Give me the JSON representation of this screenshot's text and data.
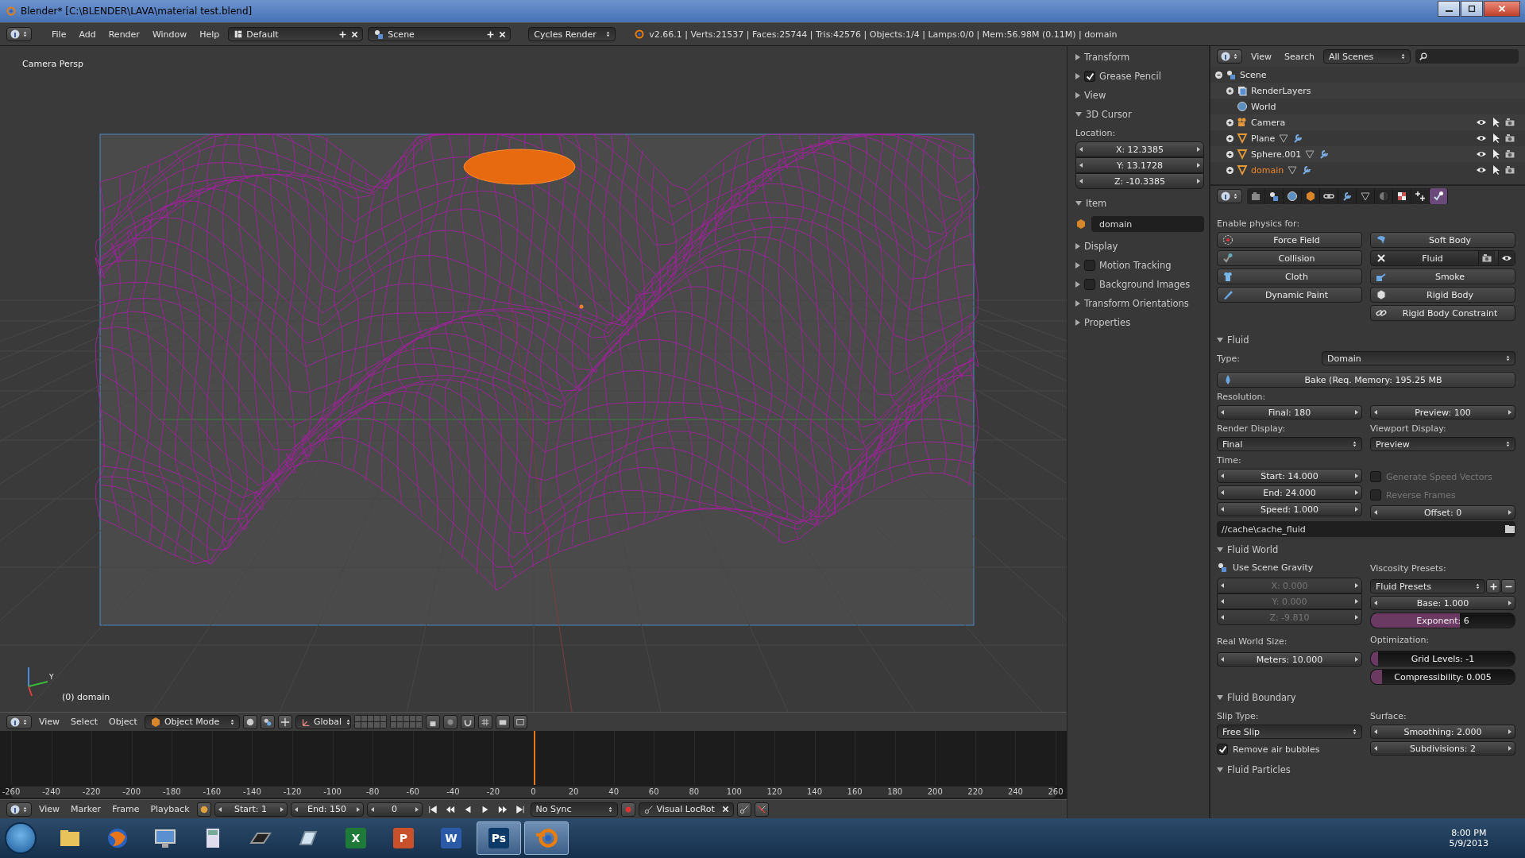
{
  "window": {
    "title": "Blender* [C:\\BLENDER\\LAVA\\material test.blend]"
  },
  "info_header": {
    "menus": [
      "File",
      "Add",
      "Render",
      "Window",
      "Help"
    ],
    "screen_layout": "Default",
    "scene": "Scene",
    "render_engine": "Cycles Render",
    "stats": "v2.66.1 | Verts:21537 | Faces:25744 | Tris:42576 | Objects:1/4 | Lamps:0/0 | Mem:56.98M (0.11M) | domain"
  },
  "viewport": {
    "view_name": "Camera Persp",
    "object_info": "(0) domain",
    "axis_label": "Y"
  },
  "view_header": {
    "menus": [
      "View",
      "Select",
      "Object"
    ],
    "mode": "Object Mode",
    "orientation": "Global"
  },
  "timeline": {
    "ticks": [
      "-260",
      "-240",
      "-220",
      "-200",
      "-180",
      "-160",
      "-140",
      "-120",
      "-100",
      "-80",
      "-60",
      "-40",
      "-20",
      "0",
      "20",
      "40",
      "60",
      "80",
      "100",
      "120",
      "140",
      "160",
      "180",
      "200",
      "220",
      "240",
      "260"
    ],
    "playhead": {
      "level": 0.5
    }
  },
  "timeline_header": {
    "menus": [
      "View",
      "Marker",
      "Frame",
      "Playback"
    ],
    "start": "Start: 1",
    "end": "End: 150",
    "current_frame": "0",
    "sync": "No Sync",
    "keying_set": "Visual LocRot"
  },
  "n_panel": {
    "panels": [
      {
        "label": "Transform",
        "kind": "plain",
        "expanded": false
      },
      {
        "label": "Grease Pencil",
        "kind": "checkbox",
        "expanded": false,
        "checked": true
      },
      {
        "label": "View",
        "kind": "plain",
        "expanded": false
      },
      {
        "label": "3D Cursor",
        "kind": "cursor",
        "expanded": true,
        "caption": "Location:",
        "fields": [
          "X: 12.3385",
          "Y: 13.1728",
          "Z: -10.3385"
        ]
      },
      {
        "label": "Item",
        "kind": "item",
        "expanded": true,
        "name": "domain"
      },
      {
        "label": "Display",
        "kind": "plain",
        "expanded": false
      },
      {
        "label": "Motion Tracking",
        "kind": "checkbox",
        "expanded": false,
        "checked": false
      },
      {
        "label": "Background Images",
        "kind": "checkbox",
        "expanded": false,
        "checked": false
      },
      {
        "label": "Transform Orientations",
        "kind": "plain",
        "expanded": false
      },
      {
        "label": "Properties",
        "kind": "plain",
        "expanded": false
      }
    ]
  },
  "outliner": {
    "menus": [
      "View",
      "Search"
    ],
    "filter": "All Scenes",
    "tree": [
      {
        "label": "Scene",
        "kind": "scene",
        "expanded": true,
        "selected": false,
        "children": [
          {
            "label": "RenderLayers",
            "kind": "renderlayers",
            "expanded": false,
            "selected": false
          },
          {
            "label": "World",
            "kind": "world",
            "selected": false
          },
          {
            "label": "Camera",
            "kind": "camera",
            "expanded": false,
            "selected": false
          },
          {
            "label": "Plane",
            "kind": "mesh",
            "expanded": false,
            "selected": false
          },
          {
            "label": "Sphere.001",
            "kind": "mesh",
            "expanded": false,
            "selected": false
          },
          {
            "label": "domain",
            "kind": "mesh",
            "expanded": false,
            "selected": true
          }
        ]
      }
    ]
  },
  "properties": {
    "tabs": [
      {
        "kind": "render",
        "selected": false
      },
      {
        "kind": "scene",
        "selected": false
      },
      {
        "kind": "world",
        "selected": false
      },
      {
        "kind": "object",
        "selected": false
      },
      {
        "kind": "constraints",
        "selected": false
      },
      {
        "kind": "modifiers",
        "selected": false
      },
      {
        "kind": "data",
        "selected": false
      },
      {
        "kind": "material",
        "selected": false
      },
      {
        "kind": "texture",
        "selected": false
      },
      {
        "kind": "particles",
        "selected": false
      },
      {
        "kind": "physics",
        "selected": true
      }
    ],
    "physics_caption": "Enable physics for:",
    "physics_columns": [
      [
        {
          "label": "Force Field",
          "kind": "force",
          "enabled": false
        },
        {
          "label": "Collision",
          "kind": "collision",
          "enabled": false
        },
        {
          "label": "Cloth",
          "kind": "cloth",
          "enabled": false
        },
        {
          "label": "Dynamic Paint",
          "kind": "paint",
          "enabled": false
        }
      ],
      [
        {
          "label": "Soft Body",
          "kind": "softbody",
          "enabled": false
        },
        {
          "label": "Fluid",
          "enabled": true
        },
        {
          "label": "Smoke",
          "kind": "smoke",
          "enabled": false
        },
        {
          "label": "Rigid Body",
          "kind": "rigid",
          "enabled": false
        },
        {
          "label": "Rigid Body Constraint",
          "kind": "constraint",
          "enabled": false
        }
      ]
    ],
    "sections": [
      {
        "kind": "fluid",
        "title": "Fluid",
        "expanded": true,
        "type_label": "Type:",
        "type": "Domain",
        "bake": "Bake (Req. Memory: 195.25 MB",
        "resolution_label": "Resolution:",
        "final": "Final: 180",
        "preview": "Preview: 100",
        "render_display_label": "Render Display:",
        "render_display": "Final",
        "viewport_display_label": "Viewport Display:",
        "viewport_display": "Preview",
        "time_label": "Time:",
        "time_fields": [
          "Start: 14.000",
          "End: 24.000",
          "Speed: 1.000"
        ],
        "options": [
          {
            "label": "Generate Speed Vectors",
            "checked": false,
            "disabled": true
          },
          {
            "label": "Reverse Frames",
            "checked": false,
            "disabled": true
          }
        ],
        "offset": "Offset: 0",
        "cache_path": "//cache\\cache_fluid"
      },
      {
        "kind": "fluid_world",
        "title": "Fluid World",
        "expanded": true,
        "gravity_label": "Use Scene Gravity",
        "gravity_fields": [
          {
            "text": "X: 0.000",
            "disabled": true
          },
          {
            "text": "Y: 0.000",
            "disabled": true
          },
          {
            "text": "Z: -9.810",
            "disabled": true
          }
        ],
        "real_world_label": "Real World Size:",
        "meters": "Meters: 10.000",
        "viscosity_label": "Viscosity Presets:",
        "presets": "Fluid Presets",
        "base": "Base: 1.000",
        "exponent": {
          "text": "Exponent: 6",
          "level": 0.62
        },
        "optimization_label": "Optimization:",
        "grid_levels": {
          "text": "Grid Levels: -1",
          "level": 0.05
        },
        "compressibility": {
          "text": "Compressibility: 0.005",
          "level": 0.08
        }
      },
      {
        "kind": "fluid_boundary",
        "title": "Fluid Boundary",
        "expanded": true,
        "slip_label": "Slip Type:",
        "slip": "Free Slip",
        "remove_bubbles": {
          "label": "Remove air bubbles",
          "checked": true
        },
        "surface_label": "Surface:",
        "smoothing": "Smoothing: 2.000",
        "subdivisions": "Subdivisions: 2"
      },
      {
        "kind": "fluid_particles",
        "title": "Fluid Particles",
        "expanded": true
      }
    ]
  },
  "taskbar": {
    "apps": [
      {
        "kind": "folder",
        "selected": false
      },
      {
        "kind": "browser",
        "selected": false
      },
      {
        "kind": "monitor",
        "selected": false
      },
      {
        "kind": "calculator",
        "selected": false
      },
      {
        "kind": "keyboard",
        "selected": false
      },
      {
        "kind": "notepad",
        "selected": false
      },
      {
        "kind": "letter",
        "glyph": "X",
        "color": "#1f7a3a",
        "selected": false
      },
      {
        "kind": "letter",
        "glyph": "P",
        "color": "#c8502a",
        "selected": false
      },
      {
        "kind": "letter",
        "glyph": "W",
        "color": "#2a5aa8",
        "selected": false
      },
      {
        "kind": "letter",
        "glyph": "Ps",
        "color": "#0d3a66",
        "selected": true
      },
      {
        "kind": "blender",
        "selected": true
      }
    ],
    "time": "8:00 PM",
    "date": "5/9/2013"
  }
}
